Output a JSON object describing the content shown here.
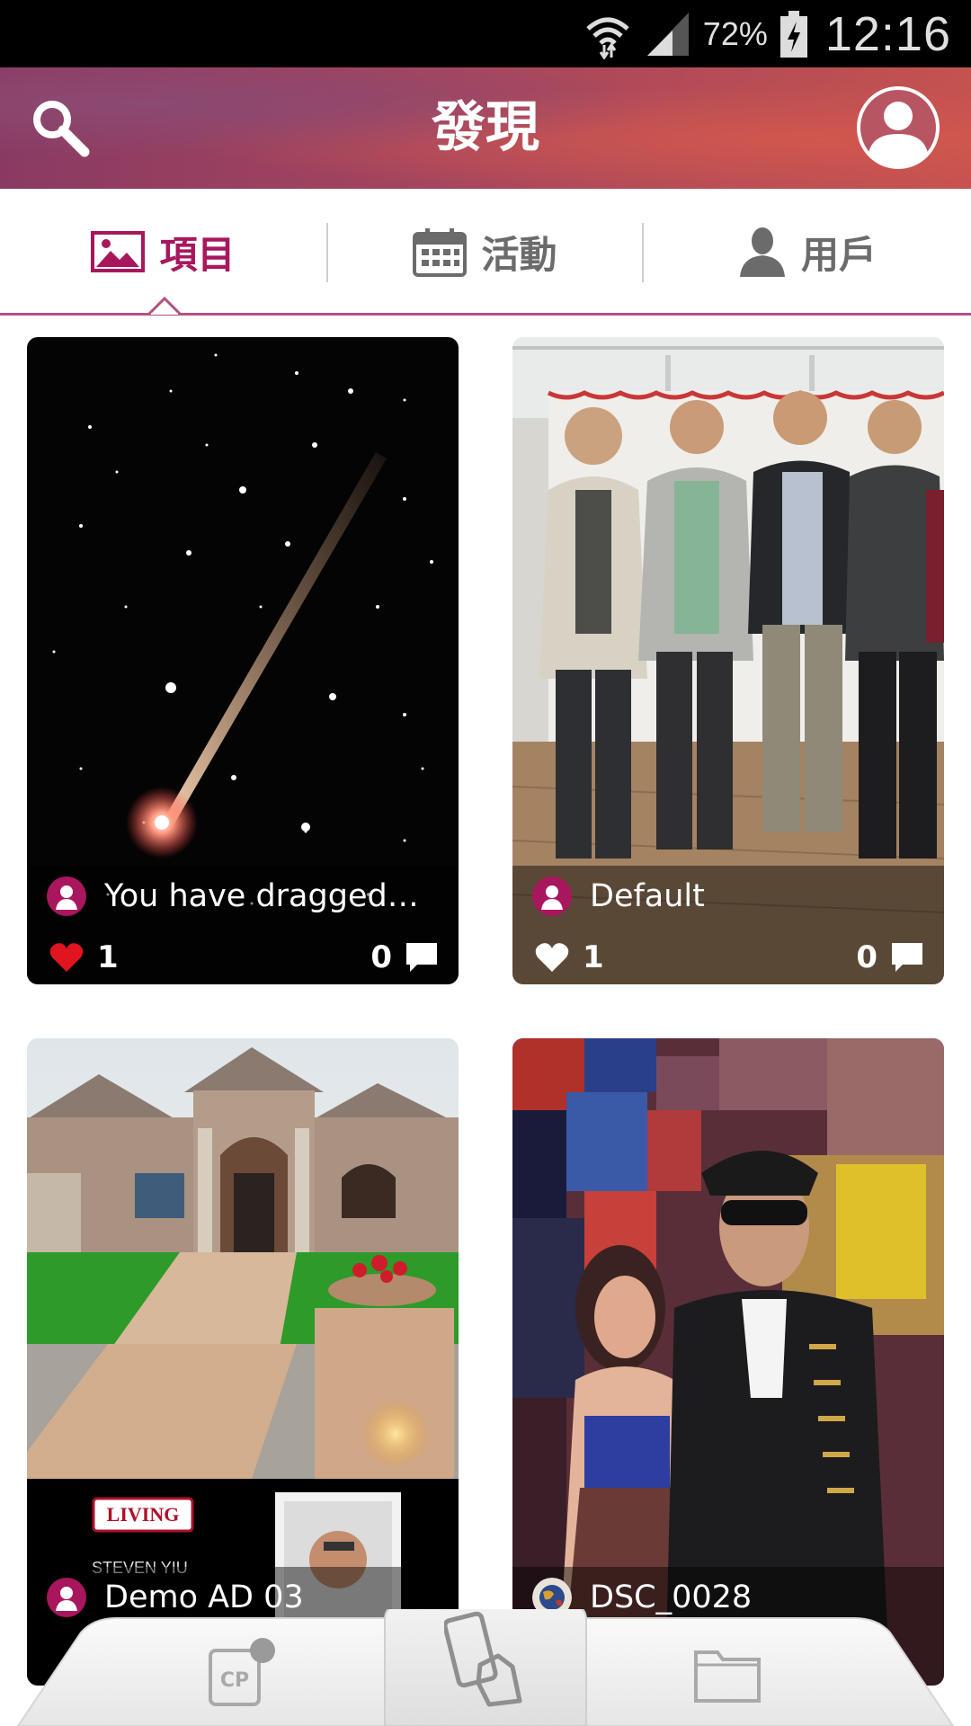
{
  "status_bar": {
    "battery_percent": "72%",
    "time": "12:16"
  },
  "header": {
    "title": "發現"
  },
  "tabs": [
    {
      "label": "項目",
      "icon": "image-icon",
      "active": true
    },
    {
      "label": "活動",
      "icon": "calendar-icon",
      "active": false
    },
    {
      "label": "用戶",
      "icon": "user-icon",
      "active": false
    }
  ],
  "cards": [
    {
      "title": "You have dragged a...",
      "likes": "1",
      "comments": "0",
      "liked": true,
      "image": "comet in starry night sky"
    },
    {
      "title": "Default",
      "likes": "1",
      "comments": "0",
      "liked": false,
      "image": "four men posing in office"
    },
    {
      "title": "Demo AD 03",
      "likes": "",
      "comments": "",
      "liked": false,
      "image": "house advertisement with realtor"
    },
    {
      "title": "DSC_0028",
      "likes": "",
      "comments": "",
      "liked": false,
      "image": "masked couple at party"
    }
  ],
  "ad_overlay": {
    "brand": "LIVING",
    "agent_name": "STEVEN YIU"
  },
  "dock": {
    "items": [
      "cp-icon",
      "phone-hand-icon",
      "folder-icon"
    ]
  },
  "colors": {
    "accent": "#a8175d",
    "header_start": "#8a3a62",
    "header_end": "#c4524f",
    "like_red": "#e0151f"
  }
}
